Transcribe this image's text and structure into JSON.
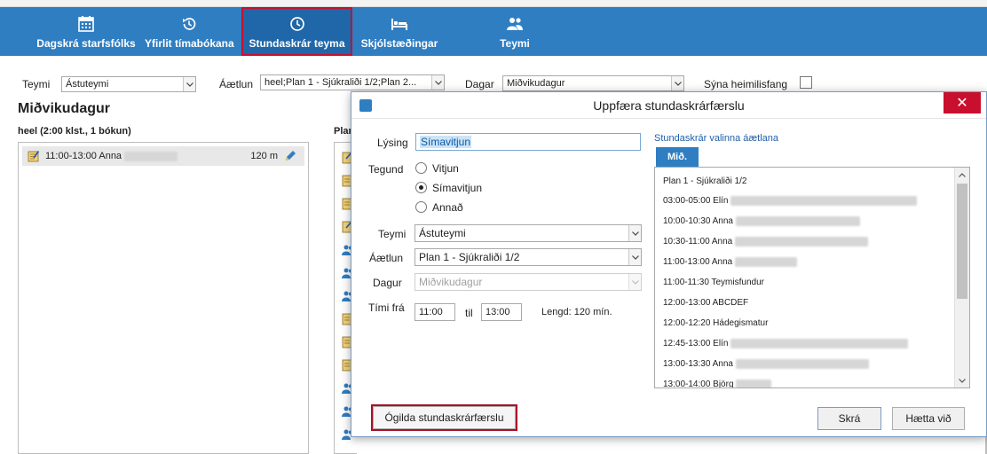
{
  "toolbar": {
    "items": [
      {
        "label": "Dagskrá starfsfólks",
        "icon": "calendar-icon"
      },
      {
        "label": "Yfirlit tímabókana",
        "icon": "history-icon"
      },
      {
        "label": "Stundaskrár teyma",
        "icon": "clock-icon",
        "active": true
      },
      {
        "label": "Skjólstæðingar",
        "icon": "bed-icon"
      },
      {
        "label": "Teymi",
        "icon": "team-icon"
      }
    ]
  },
  "filters": {
    "team_label": "Teymi",
    "team_value": "Ástuteymi",
    "plan_label": "Áætlun",
    "plan_value": "heel;Plan 1 - Sjúkraliði 1/2;Plan 2...",
    "days_label": "Dagar",
    "days_value": "Miðvikudagur",
    "show_address_label": "Sýna heimilisfang",
    "show_address_checked": false
  },
  "left_pane": {
    "day_title": "Miðvikudagur",
    "subtitle": "heel (2:00 klst., 1 bókun)",
    "booking": {
      "time": "11:00-13:00",
      "name": "Anna",
      "duration": "120 m"
    }
  },
  "mid_pane": {
    "header": "Plan"
  },
  "dialog": {
    "title": "Uppfæra stundaskrárfærslu",
    "close": "✕",
    "description_label": "Lýsing",
    "description_value": "Símavitjun",
    "type_label": "Tegund",
    "types": [
      {
        "label": "Vitjun",
        "checked": false
      },
      {
        "label": "Símavitjun",
        "checked": true
      },
      {
        "label": "Annað",
        "checked": false
      }
    ],
    "team_label": "Teymi",
    "team_value": "Ástuteymi",
    "plan_label": "Áætlun",
    "plan_value": "Plan 1 - Sjúkraliði 1/2",
    "day_label": "Dagur",
    "day_value": "Miðvikudagur",
    "time_from_label": "Tími frá",
    "time_from": "11:00",
    "time_to_label": "til",
    "time_to": "13:00",
    "length_text": "Lengd: 120 mín.",
    "schedules_title": "Stundaskrár valinna áætlana",
    "day_button": "Mið.",
    "schedule_items": [
      "Plan 1 - Sjúkraliði 1/2",
      "03:00-05:00 Elín",
      "10:00-10:30 Anna",
      "10:30-11:00 Anna",
      "11:00-13:00 Anna",
      "11:00-11:30 Teymisfundur",
      "12:00-13:00 ABCDEF",
      "12:00-12:20 Hádegismatur",
      "12:45-13:00 Elín",
      "13:00-13:30 Anna",
      "13:00-14:00 Björg"
    ],
    "invalidate_button": "Ógilda stundaskrárfærslu",
    "save_button": "Skrá",
    "cancel_button": "Hætta við"
  }
}
